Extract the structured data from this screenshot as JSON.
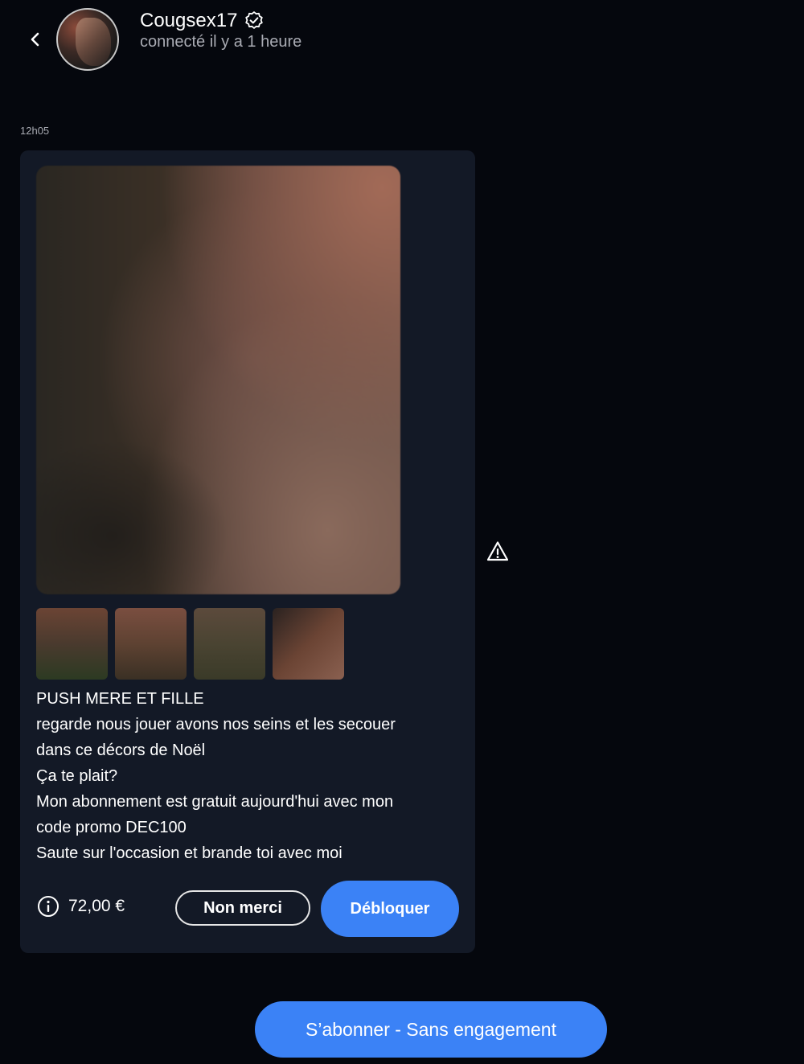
{
  "header": {
    "username": "Cougsex17",
    "status": "connecté il y a 1 heure",
    "verified_icon": "verified-check-icon",
    "back_icon": "chevron-left-icon"
  },
  "message": {
    "time": "12h05",
    "thumbnails_count": 4,
    "text_lines": [
      "PUSH MERE ET FILLE",
      "regarde nous jouer avons nos seins et les secouer",
      "dans ce décors de Noël",
      "Ça te plait?",
      "Mon abonnement est gratuit aujourd'hui avec mon",
      "code promo DEC100",
      "Saute sur l'occasion et brande toi avec moi"
    ],
    "price": "72,00 €",
    "price_icon": "info-icon",
    "decline_label": "Non merci",
    "unlock_label": "Débloquer",
    "report_icon": "warning-icon"
  },
  "footer": {
    "subscribe_label": "S’abonner - Sans engagement"
  },
  "colors": {
    "background": "#05070d",
    "card": "#131926",
    "accent": "#3b82f6",
    "muted_text": "#a9abb3"
  }
}
